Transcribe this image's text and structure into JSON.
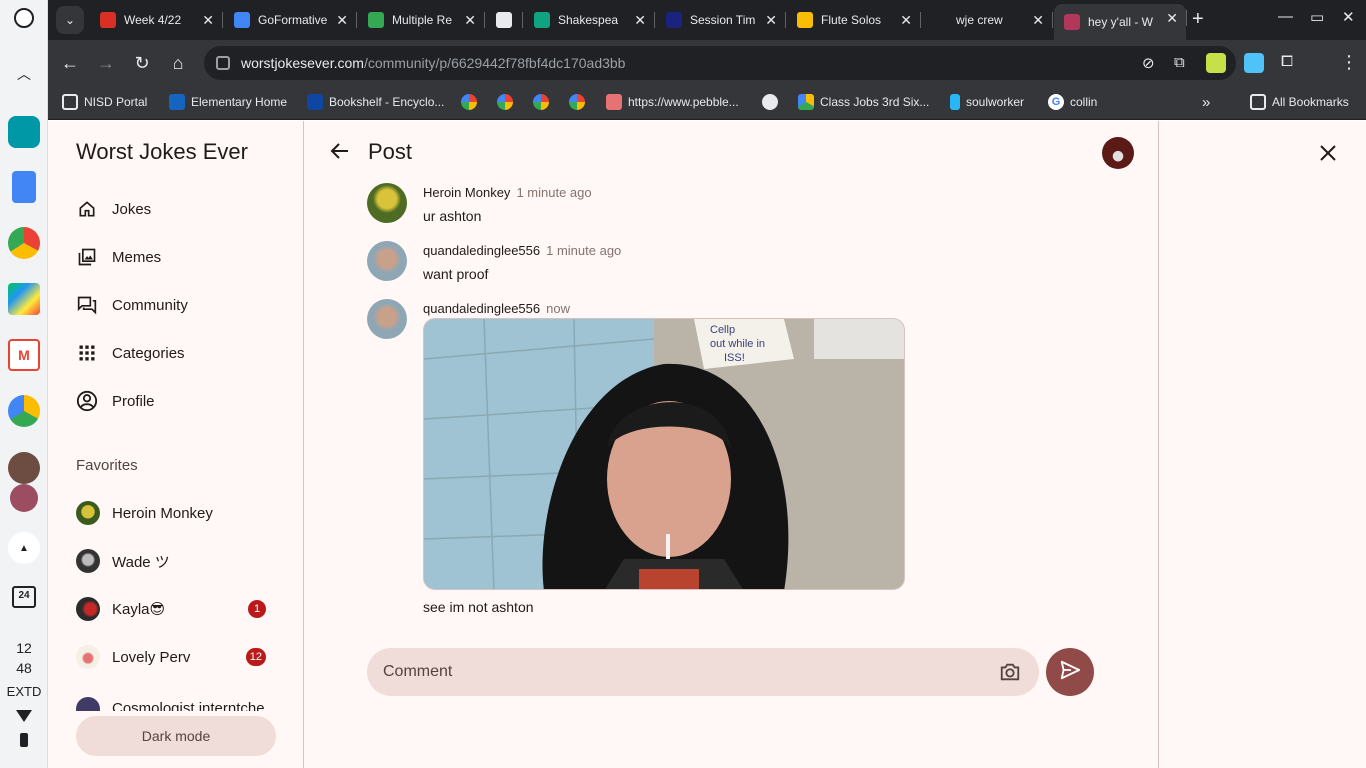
{
  "shelf": {
    "calendar_day": "24",
    "time_hours": "12",
    "time_minutes": "48",
    "display_label": "EXTD"
  },
  "tabs": [
    {
      "title": "Week 4/22",
      "color": "#d93025"
    },
    {
      "title": "GoFormative",
      "color": "#4285f4"
    },
    {
      "title": "Multiple Re",
      "color": "#34a853"
    },
    {
      "title": "",
      "color": "#e8eaed"
    },
    {
      "title": "Shakespea",
      "color": "#10a37f"
    },
    {
      "title": "Session Tim",
      "color": "#1a237e"
    },
    {
      "title": "Flute Solos",
      "color": "#fbbc04"
    },
    {
      "title": "wje crew",
      "color": "#202124"
    },
    {
      "title": "hey y'all - W",
      "color": "#b3365b"
    }
  ],
  "address_bar": {
    "host": "worstjokesever.com",
    "path": "/community/p/6629442f78fbf4dc170ad3bb"
  },
  "bookmarks": [
    "NISD Portal",
    "Elementary Home",
    "Bookshelf - Encyclo...",
    "https://www.pebble...",
    "Class Jobs 3rd Six...",
    "soulworker",
    "collin"
  ],
  "all_bookmarks_label": "All Bookmarks",
  "sidebar": {
    "brand": "Worst Jokes Ever",
    "nav": [
      "Jokes",
      "Memes",
      "Community",
      "Categories",
      "Profile"
    ],
    "favorites_heading": "Favorites",
    "favorites": [
      {
        "name": "Heroin Monkey",
        "badge": ""
      },
      {
        "name": "Wade ツ",
        "badge": ""
      },
      {
        "name": "Kayla😎",
        "badge": "1"
      },
      {
        "name": "Lovely Perv",
        "badge": "12"
      },
      {
        "name": "Cosmologist interntche",
        "badge": ""
      }
    ],
    "dark_mode_label": "Dark mode"
  },
  "post": {
    "title": "Post",
    "messages": [
      {
        "author": "Heroin Monkey",
        "time": "1 minute ago",
        "text": "ur ashton"
      },
      {
        "author": "quandaledinglee556",
        "time": "1 minute ago",
        "text": "want proof"
      },
      {
        "author": "quandaledinglee556",
        "time": "now",
        "text": "see im not ashton",
        "photo_note": "Cellphones out while in ISS!"
      }
    ],
    "comment_placeholder": "Comment"
  },
  "colors": {
    "accent": "#904a47",
    "badge": "#ba1a1a",
    "page_bg": "#fff8f6",
    "input_bg": "#f0dcd9"
  }
}
